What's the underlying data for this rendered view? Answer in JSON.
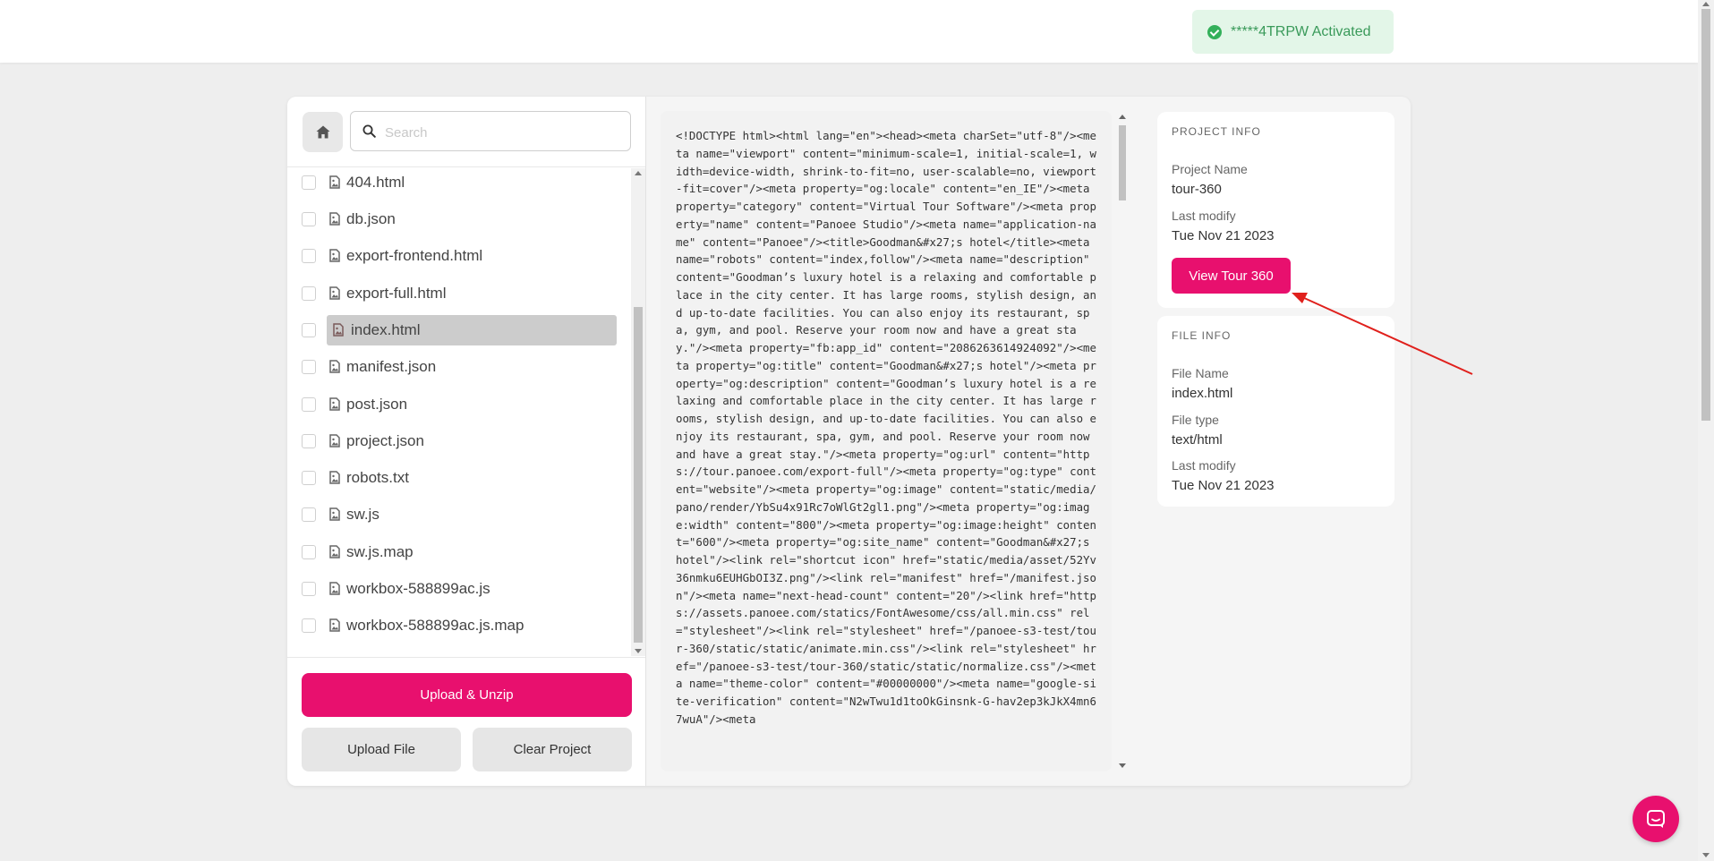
{
  "toast": {
    "text": "*****4TRPW Activated",
    "icon": "check-circle-icon",
    "color": "#33b05a"
  },
  "sidebar": {
    "search_placeholder": "Search",
    "home_icon": "home-icon",
    "files": [
      {
        "name": "404.html",
        "selected": false
      },
      {
        "name": "db.json",
        "selected": false
      },
      {
        "name": "export-frontend.html",
        "selected": false
      },
      {
        "name": "export-full.html",
        "selected": false
      },
      {
        "name": "index.html",
        "selected": true
      },
      {
        "name": "manifest.json",
        "selected": false
      },
      {
        "name": "post.json",
        "selected": false
      },
      {
        "name": "project.json",
        "selected": false
      },
      {
        "name": "robots.txt",
        "selected": false
      },
      {
        "name": "sw.js",
        "selected": false
      },
      {
        "name": "sw.js.map",
        "selected": false
      },
      {
        "name": "workbox-588899ac.js",
        "selected": false
      },
      {
        "name": "workbox-588899ac.js.map",
        "selected": false
      }
    ],
    "upload_unzip_label": "Upload & Unzip",
    "upload_file_label": "Upload File",
    "clear_project_label": "Clear Project"
  },
  "code": {
    "content": "<!DOCTYPE html><html lang=\"en\"><head><meta charSet=\"utf-8\"/><meta name=\"viewport\" content=\"minimum-scale=1, initial-scale=1, width=device-width, shrink-to-fit=no, user-scalable=no, viewport-fit=cover\"/><meta property=\"og:locale\" content=\"en_IE\"/><meta property=\"category\" content=\"Virtual Tour Software\"/><meta property=\"name\" content=\"Panoee Studio\"/><meta name=\"application-name\" content=\"Panoee\"/><title>Goodman&#x27;s hotel</title><meta name=\"robots\" content=\"index,follow\"/><meta name=\"description\" content=\"Goodman’s luxury hotel is a relaxing and comfortable place in the city center. It has large rooms, stylish design, and up-to-date facilities. You can also enjoy its restaurant, spa, gym, and pool. Reserve your room now and have a great stay.\"/><meta property=\"fb:app_id\" content=\"2086263614924092\"/><meta property=\"og:title\" content=\"Goodman&#x27;s hotel\"/><meta property=\"og:description\" content=\"Goodman’s luxury hotel is a relaxing and comfortable place in the city center. It has large rooms, stylish design, and up-to-date facilities. You can also enjoy its restaurant, spa, gym, and pool. Reserve your room now and have a great stay.\"/><meta property=\"og:url\" content=\"https://tour.panoee.com/export-full\"/><meta property=\"og:type\" content=\"website\"/><meta property=\"og:image\" content=\"static/media/pano/render/YbSu4x91Rc7oWlGt2gl1.png\"/><meta property=\"og:image:width\" content=\"800\"/><meta property=\"og:image:height\" content=\"600\"/><meta property=\"og:site_name\" content=\"Goodman&#x27;s hotel\"/><link rel=\"shortcut icon\" href=\"static/media/asset/52Yv36nmku6EUHGbOI3Z.png\"/><link rel=\"manifest\" href=\"/manifest.json\"/><meta name=\"next-head-count\" content=\"20\"/><link href=\"https://assets.panoee.com/statics/FontAwesome/css/all.min.css\" rel=\"stylesheet\"/><link rel=\"stylesheet\" href=\"/panoee-s3-test/tour-360/static/static/animate.min.css\"/><link rel=\"stylesheet\" href=\"/panoee-s3-test/tour-360/static/static/normalize.css\"/><meta name=\"theme-color\" content=\"#00000000\"/><meta name=\"google-site-verification\" content=\"N2wTwu1d1toOkGinsnk-G-hav2ep3kJkX4mn67wuA\"/><meta"
  },
  "project_info": {
    "heading": "PROJECT INFO",
    "name_label": "Project Name",
    "name_value": "tour-360",
    "modify_label": "Last modify",
    "modify_value": "Tue Nov 21 2023",
    "view_button_label": "View Tour 360"
  },
  "file_info": {
    "heading": "FILE INFO",
    "name_label": "File Name",
    "name_value": "index.html",
    "type_label": "File type",
    "type_value": "text/html",
    "modify_label": "Last modify",
    "modify_value": "Tue Nov 21 2023"
  },
  "colors": {
    "accent": "#e8106e",
    "arrow": "#e0201c",
    "toast_bg": "#e3f6e8"
  },
  "chat": {
    "icon": "chat-bubble-icon"
  }
}
